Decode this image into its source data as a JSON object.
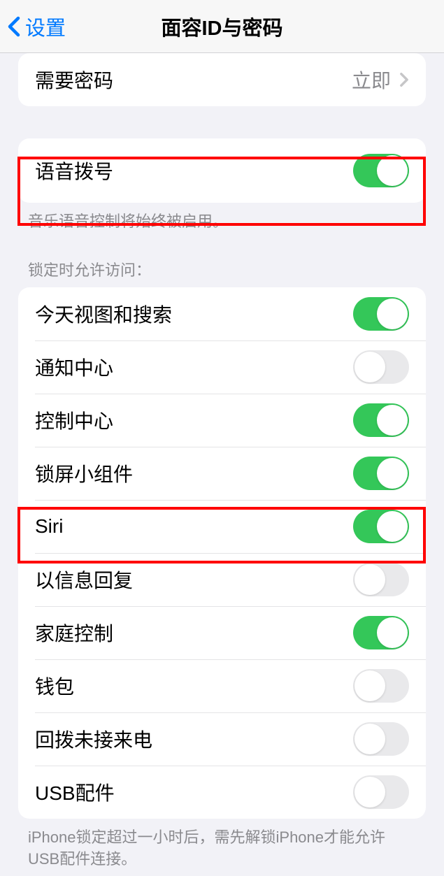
{
  "header": {
    "back": "设置",
    "title": "面容ID与密码"
  },
  "section1": {
    "require_passcode": "需要密码",
    "value": "立即"
  },
  "section2": {
    "voice_dial": "语音拨号",
    "footer": "音乐语音控制将始终被启用。"
  },
  "section3": {
    "header": "锁定时允许访问：",
    "today": "今天视图和搜索",
    "notifications": "通知中心",
    "control_center": "控制中心",
    "widgets": "锁屏小组件",
    "siri": "Siri",
    "reply_message": "以信息回复",
    "home_control": "家庭控制",
    "wallet": "钱包",
    "return_calls": "回拨未接来电",
    "usb": "USB配件",
    "footer": "iPhone锁定超过一小时后，需先解锁iPhone才能允许USB配件连接。"
  },
  "toggles": {
    "voice_dial": true,
    "today": true,
    "notifications": false,
    "control_center": true,
    "widgets": true,
    "siri": true,
    "reply_message": false,
    "home_control": true,
    "wallet": false,
    "return_calls": false,
    "usb": false
  }
}
